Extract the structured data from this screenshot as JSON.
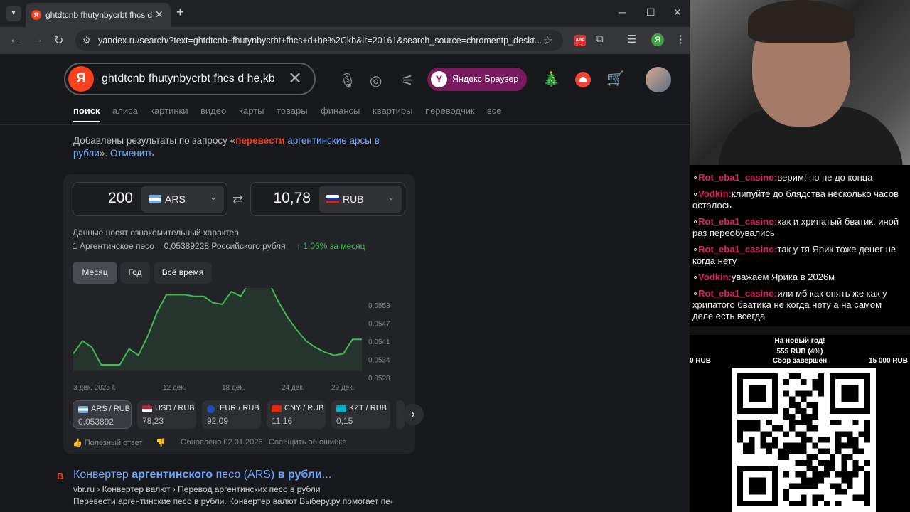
{
  "browser": {
    "tab_title": "ghtdtcnb fhutynbycrbt fhcs d he,kb",
    "url": "yandex.ru/search/?text=ghtdtcnb+fhutynbycrbt+fhcs+d+he%2Ckb&lr=20161&search_source=chromentp_deskt...",
    "ext_abp": "ABP",
    "profile_initial": "Я"
  },
  "yandex": {
    "logo": "Я",
    "query": "ghtdtcnb fhutynbycrbt fhcs d he,kb",
    "browser_promo": "Яндекс Браузер",
    "tabs": [
      "поиск",
      "алиса",
      "картинки",
      "видео",
      "карты",
      "товары",
      "финансы",
      "квартиры",
      "переводчик",
      "все"
    ],
    "note_prefix": "Добавлены результаты по запросу «",
    "note_highlight": "перевести",
    "note_query": " аргентинские арсы в рубли",
    "note_mid": "». ",
    "note_cancel": "Отменить"
  },
  "converter": {
    "from_amount": "200",
    "from_code": "ARS",
    "to_amount": "10,78",
    "to_code": "RUB",
    "disclaimer": "Данные носят ознакомительный характер",
    "rate_text": "1 Аргентинское песо = 0,05389228 Российского рубля",
    "change": "↑ 1,06% за месяц",
    "periods": [
      "Месяц",
      "Год",
      "Всё время"
    ],
    "pairs": [
      {
        "name": "ARS / RUB",
        "value": "0,053892"
      },
      {
        "name": "USD / RUB",
        "value": "78,23"
      },
      {
        "name": "EUR / RUB",
        "value": "92,09"
      },
      {
        "name": "CNY / RUB",
        "value": "11,16"
      },
      {
        "name": "KZT / RUB",
        "value": "0,15"
      }
    ],
    "footer_helpful": "Полезный ответ",
    "footer_updated": "Обновлено 02.01.2026",
    "footer_report": "Сообщить об ошибке"
  },
  "chart_data": {
    "type": "area",
    "x_tick_labels": [
      "3 дек. 2025 г.",
      "12 дек.",
      "18 дек.",
      "24 дек.",
      "29 дек."
    ],
    "y_tick_labels": [
      "0,0553",
      "0,0547",
      "0,0541",
      "0,0534",
      "0,0528"
    ],
    "ylim": [
      0.0528,
      0.0553
    ],
    "values": [
      0.05335,
      0.05375,
      0.05355,
      0.053,
      0.053,
      0.053,
      0.0535,
      0.0533,
      0.0539,
      0.05465,
      0.0552,
      0.0552,
      0.0552,
      0.05515,
      0.05515,
      0.05495,
      0.0549,
      0.0553,
      0.05515,
      0.05565,
      0.0556,
      0.0556,
      0.055,
      0.0545,
      0.0541,
      0.05375,
      0.05355,
      0.0534,
      0.0533,
      0.05335,
      0.0538,
      0.0538
    ],
    "line_color": "#3fb950"
  },
  "result": {
    "favicon": "B",
    "title_plain_1": "Конвертер ",
    "title_bold_1": "аргентинского",
    "title_plain_2": " песо (ARS) ",
    "title_bold_2": "в рубли",
    "title_end": "...",
    "path": "vbr.ru › Конвертер валют › Перевод аргентинских песо в рубли",
    "snippet": "Перевести аргентинские песо в рубли. Конвертер валют Выберу.ру помогает пе-"
  },
  "stream": {
    "chat": [
      {
        "user": "Rot_eba1_casino:",
        "color": "#e0245e",
        "text": "верим! но не до конца"
      },
      {
        "user": "Vodkin:",
        "color": "#e0245e",
        "text": "клипуйте до блядства несколько часов осталось"
      },
      {
        "user": "Rot_eba1_casino:",
        "color": "#e0245e",
        "text": "как и хрипатый бватик, иной раз переобувались"
      },
      {
        "user": "Rot_eba1_casino:",
        "color": "#e0245e",
        "text": "так у тя Ярик тоже денег не когда нету"
      },
      {
        "user": "Vodkin:",
        "color": "#e0245e",
        "text": "уважаем Ярика в 2026м"
      },
      {
        "user": "Rot_eba1_casino:",
        "color": "#e0245e",
        "text": "или мб как опять же как у хрипатого бватика не когда нету а на самом деле есть всегда"
      }
    ],
    "goal_title": "На новый год!",
    "goal_progress": "555 RUB (4%)",
    "goal_min": "0 RUB",
    "goal_status": "Сбор завершён",
    "goal_max": "15 000 RUB",
    "goal_fraction": 0.04
  }
}
